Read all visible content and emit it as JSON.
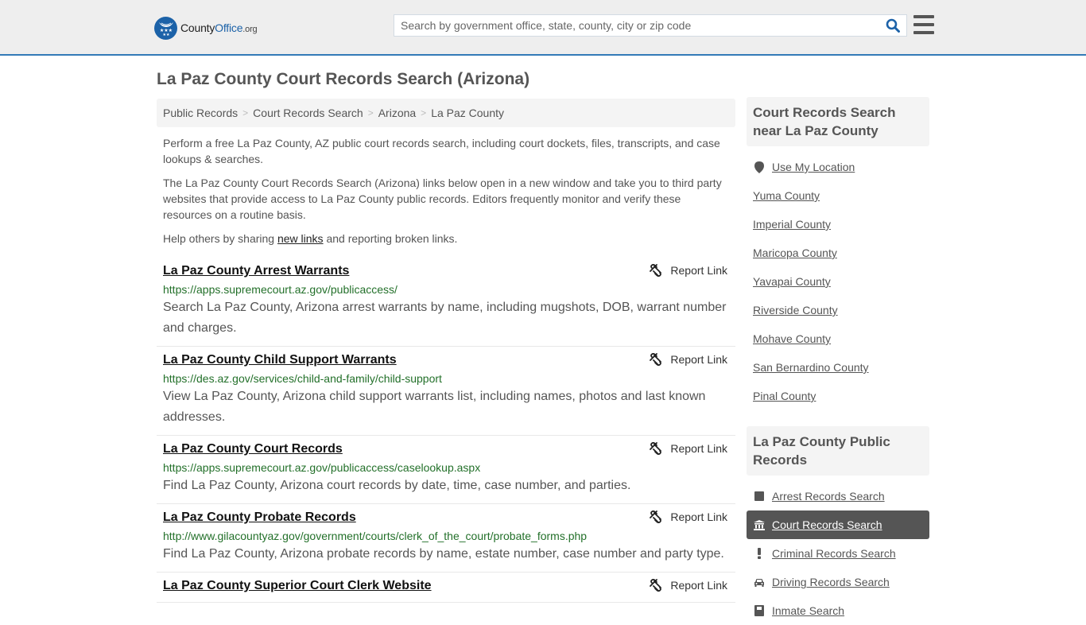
{
  "header": {
    "logo": {
      "brand_part1": "County",
      "brand_part2": "Office",
      "brand_suffix": ".org"
    },
    "search": {
      "placeholder": "Search by government office, state, county, city or zip code",
      "value": ""
    },
    "icons": {
      "search": "search-icon",
      "menu": "hamburger-menu-icon"
    }
  },
  "page_title": "La Paz County Court Records Search (Arizona)",
  "breadcrumb": [
    "Public Records",
    "Court Records Search",
    "Arizona",
    "La Paz County"
  ],
  "intro": {
    "p1": "Perform a free La Paz County, AZ public court records search, including court dockets, files, transcripts, and case lookups & searches.",
    "p2": "The La Paz County Court Records Search (Arizona) links below open in a new window and take you to third party websites that provide access to La Paz County public records. Editors frequently monitor and verify these resources on a routine basis.",
    "p3_before": "Help others by sharing ",
    "p3_link": "new links",
    "p3_after": " and reporting broken links."
  },
  "report_label": "Report Link",
  "links": [
    {
      "title": "La Paz County Arrest Warrants",
      "url": "https://apps.supremecourt.az.gov/publicaccess/",
      "desc": "Search La Paz County, Arizona arrest warrants by name, including mugshots, DOB, warrant number and charges."
    },
    {
      "title": "La Paz County Child Support Warrants",
      "url": "https://des.az.gov/services/child-and-family/child-support",
      "desc": "View La Paz County, Arizona child support warrants list, including names, photos and last known addresses."
    },
    {
      "title": "La Paz County Court Records",
      "url": "https://apps.supremecourt.az.gov/publicaccess/caselookup.aspx",
      "desc": "Find La Paz County, Arizona court records by date, time, case number, and parties."
    },
    {
      "title": "La Paz County Probate Records",
      "url": "http://www.gilacountyaz.gov/government/courts/clerk_of_the_court/probate_forms.php",
      "desc": "Find La Paz County, Arizona probate records by name, estate number, case number and party type."
    },
    {
      "title": "La Paz County Superior Court Clerk Website",
      "url": "",
      "desc": ""
    }
  ],
  "sidebar": {
    "nearby_heading": "Court Records Search near La Paz County",
    "use_location": "Use My Location",
    "nearby": [
      "Yuma County",
      "Imperial County",
      "Maricopa County",
      "Yavapai County",
      "Riverside County",
      "Mohave County",
      "San Bernardino County",
      "Pinal County"
    ],
    "public_heading": "La Paz County Public Records",
    "public_records": [
      {
        "label": "Arrest Records Search",
        "icon": "square-icon",
        "active": false
      },
      {
        "label": "Court Records Search",
        "icon": "courthouse-icon",
        "active": true
      },
      {
        "label": "Criminal Records Search",
        "icon": "exclamation-icon",
        "active": false
      },
      {
        "label": "Driving Records Search",
        "icon": "car-icon",
        "active": false
      },
      {
        "label": "Inmate Search",
        "icon": "inmate-icon",
        "active": false
      }
    ]
  },
  "colors": {
    "accent": "#337ab7",
    "logo_blue": "#1c62a8",
    "url_green": "#23702a",
    "active_bg": "#555555"
  }
}
